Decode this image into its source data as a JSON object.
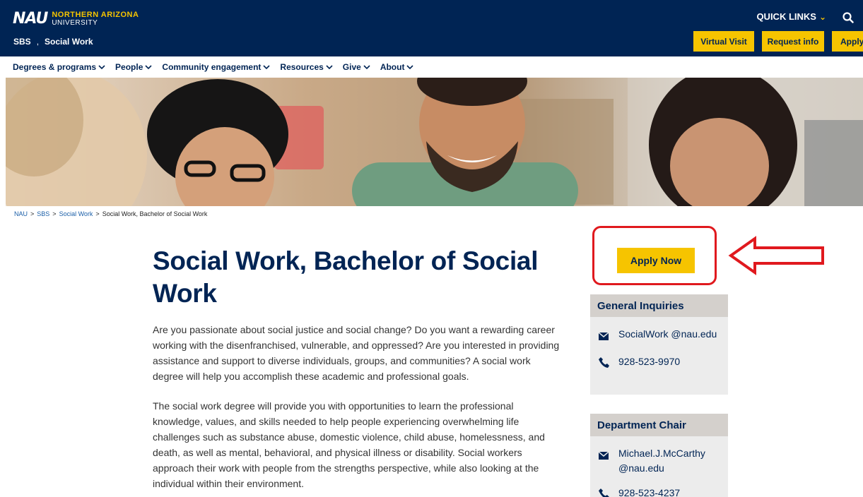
{
  "header": {
    "logo_mark": "NAU",
    "logo_line1": "NORTHERN ARIZONA",
    "logo_line2": "UNIVERSITY",
    "site_crumb": [
      "SBS",
      ",",
      "Social Work"
    ],
    "quick_links": "QUICK LINKS",
    "buttons": {
      "virtual_visit": "Virtual Visit",
      "request_info": "Request info",
      "apply": "Apply"
    },
    "icons": {
      "search": "search-icon",
      "quicklinks_chevron": "chevron-down-icon"
    }
  },
  "nav": {
    "items": [
      {
        "label": "Degrees & programs"
      },
      {
        "label": "People"
      },
      {
        "label": "Community engagement"
      },
      {
        "label": "Resources"
      },
      {
        "label": "Give"
      },
      {
        "label": "About"
      }
    ]
  },
  "breadcrumb": {
    "items": [
      "NAU",
      ">",
      "SBS",
      ">",
      "Social Work",
      ">",
      "Social Work, Bachelor of Social Work"
    ]
  },
  "main": {
    "title": "Social Work, Bachelor of Social Work",
    "paragraph1": "Are you passionate about social justice and social change? Do you want a rewarding career working with the disenfranchised, vulnerable, and oppressed? Are you interested in providing assistance and support to diverse individuals, groups, and communities? A social work degree will help you accomplish these academic and professional goals.",
    "paragraph2": "The social work degree will provide you with opportunities to learn the professional knowledge, values, and skills needed to help people experiencing overwhelming life challenges such as substance abuse, domestic violence, child abuse, homelessness, and death, as well as mental, behavioral, and physical illness or disability. Social workers approach their work with people from the strengths perspective, while also looking at the individual within their environment."
  },
  "sidebar": {
    "apply_now": "Apply Now",
    "general": {
      "heading": "General Inquiries",
      "email": "SocialWork @nau.edu",
      "phone": "928-523-9970"
    },
    "chair": {
      "heading": "Department Chair",
      "email": "Michael.J.McCarthy @nau.edu",
      "phone": "928-523-4237"
    }
  },
  "colors": {
    "navy": "#002454",
    "gold": "#f6c400",
    "highlight_red": "#e0191e",
    "card_bg": "#ececec",
    "card_head_bg": "#d4d0cc"
  }
}
